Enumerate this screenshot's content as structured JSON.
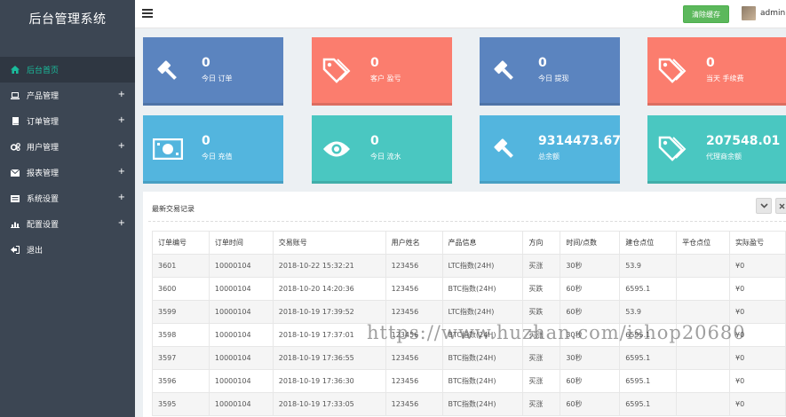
{
  "app": {
    "title": "后台管理系统"
  },
  "sidebar": {
    "items": [
      {
        "label": "后台首页",
        "icon": "home-icon",
        "expandable": false,
        "active": true
      },
      {
        "label": "产品管理",
        "icon": "laptop-icon",
        "expandable": true
      },
      {
        "label": "订单管理",
        "icon": "book-icon",
        "expandable": true
      },
      {
        "label": "用户管理",
        "icon": "cogs-icon",
        "expandable": true
      },
      {
        "label": "报表管理",
        "icon": "envelope-icon",
        "expandable": true
      },
      {
        "label": "系统设置",
        "icon": "list-icon",
        "expandable": true
      },
      {
        "label": "配置设置",
        "icon": "bar-chart-icon",
        "expandable": true
      },
      {
        "label": "退出",
        "icon": "sign-out-icon",
        "expandable": false
      }
    ],
    "plus": "+"
  },
  "topbar": {
    "clear_cache_label": "清除缓存",
    "user": "admin"
  },
  "stats": [
    {
      "value": "0",
      "label": "今日 订单",
      "icon": "gavel-icon",
      "color": "#5b84bf"
    },
    {
      "value": "0",
      "label": "客户 盈亏",
      "icon": "tags-icon",
      "color": "#fb7d6e"
    },
    {
      "value": "0",
      "label": "今日 提现",
      "icon": "gavel-icon",
      "color": "#5b84bf"
    },
    {
      "value": "0",
      "label": "当天 手续费",
      "icon": "tags-icon",
      "color": "#fb7d6e"
    },
    {
      "value": "0",
      "label": "今日 充值",
      "icon": "money-icon",
      "color": "#53b5de"
    },
    {
      "value": "0",
      "label": "今日 流水",
      "icon": "eye-icon",
      "color": "#4ac7c1"
    },
    {
      "value": "9314473.67",
      "label": "总余额",
      "icon": "gavel-icon",
      "color": "#53b5de"
    },
    {
      "value": "207548.01",
      "label": "代理商余额",
      "icon": "tags-icon",
      "color": "#4ac7c1"
    }
  ],
  "panel": {
    "title": "最新交易记录",
    "collapse_icon": "chevron-down-icon",
    "close_icon": "close-icon",
    "columns": [
      "订单编号",
      "订单时间",
      "交易账号",
      "用户姓名",
      "产品信息",
      "方向",
      "时间/点数",
      "建仓点位",
      "平仓点位",
      "实际盈亏"
    ],
    "rows": [
      [
        "3601",
        "10000104",
        "2018-10-22 15:32:21",
        "123456",
        "LTC指数(24H)",
        "买涨",
        "30秒",
        "53.9",
        "",
        "¥0"
      ],
      [
        "3600",
        "10000104",
        "2018-10-20 14:20:36",
        "123456",
        "BTC指数(24H)",
        "买跌",
        "60秒",
        "6595.1",
        "",
        "¥0"
      ],
      [
        "3599",
        "10000104",
        "2018-10-19 17:39:52",
        "123456",
        "LTC指数(24H)",
        "买跌",
        "60秒",
        "53.9",
        "",
        "¥0"
      ],
      [
        "3598",
        "10000104",
        "2018-10-19 17:37:01",
        "123456",
        "BTC指数(24H)",
        "买涨",
        "30秒",
        "6595.1",
        "",
        "¥0"
      ],
      [
        "3597",
        "10000104",
        "2018-10-19 17:36:55",
        "123456",
        "BTC指数(24H)",
        "买涨",
        "30秒",
        "6595.1",
        "",
        "¥0"
      ],
      [
        "3596",
        "10000104",
        "2018-10-19 17:36:30",
        "123456",
        "BTC指数(24H)",
        "买涨",
        "60秒",
        "6595.1",
        "",
        "¥0"
      ],
      [
        "3595",
        "10000104",
        "2018-10-19 17:33:05",
        "123456",
        "BTC指数(24H)",
        "买涨",
        "60秒",
        "6595.1",
        "",
        "¥0"
      ]
    ]
  },
  "watermark": "https://www.huzhan.com/ishop20680",
  "colors": {
    "sidebar": "#3c4653",
    "active_text": "#1abc9c",
    "button_green": "#5cb85c"
  }
}
